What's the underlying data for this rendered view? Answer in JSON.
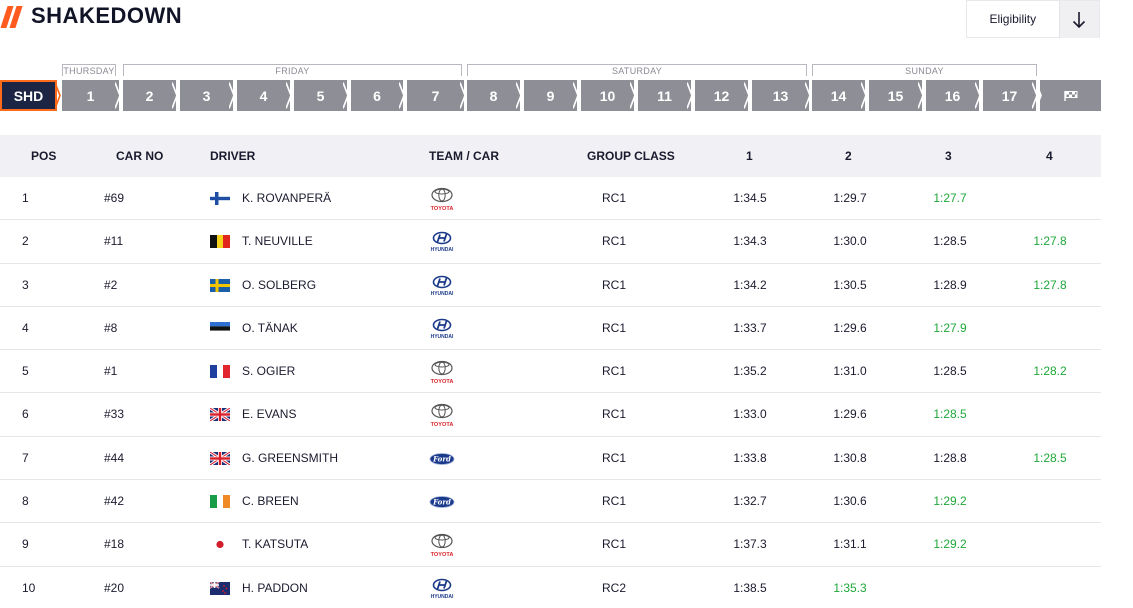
{
  "header": {
    "title": "SHAKEDOWN",
    "eligibility_label": "Eligibility",
    "sort_icon": "arrow-down-icon",
    "accent_color": "#ff5a1f"
  },
  "days": [
    {
      "label": "THURSDAY"
    },
    {
      "label": "FRIDAY"
    },
    {
      "label": "SATURDAY"
    },
    {
      "label": "SUNDAY"
    }
  ],
  "stages": [
    "SHD",
    "1",
    "2",
    "3",
    "4",
    "5",
    "6",
    "7",
    "8",
    "9",
    "10",
    "11",
    "12",
    "13",
    "14",
    "15",
    "16",
    "17"
  ],
  "finish_icon": "checkered-flag-icon",
  "table": {
    "headers": [
      "POS",
      "CAR NO",
      "DRIVER",
      "TEAM / CAR",
      "GROUP CLASS",
      "1",
      "2",
      "3",
      "4"
    ],
    "best_color": "#1fa83a",
    "rows": [
      {
        "pos": "1",
        "car": "#69",
        "flag": "FIN",
        "driver": "K. ROVANPERÄ",
        "team": "toyota",
        "class": "RC1",
        "t1": "1:34.5",
        "t2": "1:29.7",
        "t3": "1:27.7",
        "t4": "",
        "best": 3
      },
      {
        "pos": "2",
        "car": "#11",
        "flag": "BEL",
        "driver": "T. NEUVILLE",
        "team": "hyundai",
        "class": "RC1",
        "t1": "1:34.3",
        "t2": "1:30.0",
        "t3": "1:28.5",
        "t4": "1:27.8",
        "best": 4
      },
      {
        "pos": "3",
        "car": "#2",
        "flag": "SWE",
        "driver": "O. SOLBERG",
        "team": "hyundai",
        "class": "RC1",
        "t1": "1:34.2",
        "t2": "1:30.5",
        "t3": "1:28.9",
        "t4": "1:27.8",
        "best": 4
      },
      {
        "pos": "4",
        "car": "#8",
        "flag": "EST",
        "driver": "O. TÄNAK",
        "team": "hyundai",
        "class": "RC1",
        "t1": "1:33.7",
        "t2": "1:29.6",
        "t3": "1:27.9",
        "t4": "",
        "best": 3
      },
      {
        "pos": "5",
        "car": "#1",
        "flag": "FRA",
        "driver": "S. OGIER",
        "team": "toyota",
        "class": "RC1",
        "t1": "1:35.2",
        "t2": "1:31.0",
        "t3": "1:28.5",
        "t4": "1:28.2",
        "best": 4
      },
      {
        "pos": "6",
        "car": "#33",
        "flag": "GBR",
        "driver": "E. EVANS",
        "team": "toyota",
        "class": "RC1",
        "t1": "1:33.0",
        "t2": "1:29.6",
        "t3": "1:28.5",
        "t4": "",
        "best": 3
      },
      {
        "pos": "7",
        "car": "#44",
        "flag": "GBR",
        "driver": "G. GREENSMITH",
        "team": "ford",
        "class": "RC1",
        "t1": "1:33.8",
        "t2": "1:30.8",
        "t3": "1:28.8",
        "t4": "1:28.5",
        "best": 4
      },
      {
        "pos": "8",
        "car": "#42",
        "flag": "IRL",
        "driver": "C. BREEN",
        "team": "ford",
        "class": "RC1",
        "t1": "1:32.7",
        "t2": "1:30.6",
        "t3": "1:29.2",
        "t4": "",
        "best": 3
      },
      {
        "pos": "9",
        "car": "#18",
        "flag": "JPN",
        "driver": "T. KATSUTA",
        "team": "toyota",
        "class": "RC1",
        "t1": "1:37.3",
        "t2": "1:31.1",
        "t3": "1:29.2",
        "t4": "",
        "best": 3
      },
      {
        "pos": "10",
        "car": "#20",
        "flag": "NZL",
        "driver": "H. PADDON",
        "team": "hyundai",
        "class": "RC2",
        "t1": "1:38.5",
        "t2": "1:35.3",
        "t3": "",
        "t4": "",
        "best": 2
      }
    ]
  }
}
